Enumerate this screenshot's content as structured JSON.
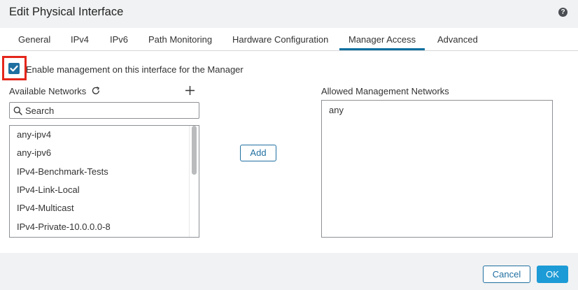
{
  "dialog": {
    "title": "Edit Physical Interface",
    "help_icon": "question-circle-icon"
  },
  "tabs": [
    {
      "label": "General",
      "active": false
    },
    {
      "label": "IPv4",
      "active": false
    },
    {
      "label": "IPv6",
      "active": false
    },
    {
      "label": "Path Monitoring",
      "active": false
    },
    {
      "label": "Hardware Configuration",
      "active": false
    },
    {
      "label": "Manager Access",
      "active": true
    },
    {
      "label": "Advanced",
      "active": false
    }
  ],
  "manager_access": {
    "enable_checkbox": {
      "label": "Enable management on this interface for the Manager",
      "checked": true
    },
    "available_networks": {
      "label": "Available Networks",
      "refresh_icon": "refresh-icon",
      "add_icon": "plus-icon",
      "search_placeholder": "Search",
      "items": [
        "any-ipv4",
        "any-ipv6",
        "IPv4-Benchmark-Tests",
        "IPv4-Link-Local",
        "IPv4-Multicast",
        "IPv4-Private-10.0.0.0-8"
      ]
    },
    "add_button": "Add",
    "allowed_networks": {
      "label": "Allowed Management Networks",
      "items": [
        "any"
      ]
    }
  },
  "footer": {
    "cancel": "Cancel",
    "ok": "OK"
  },
  "colors": {
    "accent": "#1f6fa0",
    "primary_button": "#1d9bd6",
    "highlight": "#e4261b"
  }
}
